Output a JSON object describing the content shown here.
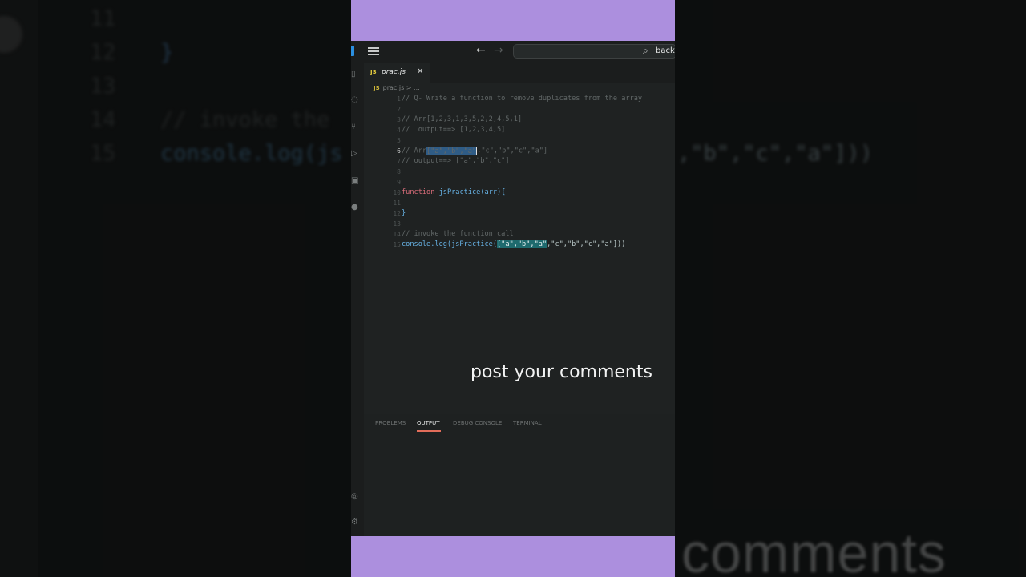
{
  "background": {
    "line_numbers": [
      "11",
      "12",
      "13",
      "14",
      "15"
    ],
    "closing_brace": "}",
    "comment_fragment": "// invoke the",
    "console_fragment": "console.log(js",
    "array_fragment": ",\"b\",\"c\",\"a\"]))",
    "caption_fragment": "comments"
  },
  "titlebar": {
    "search_label": "back"
  },
  "tab": {
    "icon": "JS",
    "label": "prac.js",
    "close": "✕"
  },
  "breadcrumb": {
    "icon": "JS",
    "path": "prac.js > ..."
  },
  "editor": {
    "line_numbers": [
      "1",
      "2",
      "3",
      "4",
      "5",
      "6",
      "7",
      "8",
      "9",
      "10",
      "11",
      "12",
      "13",
      "14",
      "15"
    ],
    "active_line": "6",
    "lines": {
      "l1": "// Q- Write a function to remove duplicates from the array",
      "l3": "// Arr[1,2,3,1,3,5,2,2,4,5,1]",
      "l4": "//  output==> [1,2,3,4,5]",
      "l6a": "// Arr",
      "l6b": "[\"a\",\"b\",\"a\"",
      "l6c": ",\"c\",\"b\",\"c\",\"a\"]",
      "l7a": "// output==> [\"a\",\"b\",",
      "l7b": "\"c\"]",
      "l10_kw": "function",
      "l10_fn": "jsPractice",
      "l10_rest": "(arr){",
      "l12": "}",
      "l14": "// invoke the function call",
      "l15_fn": "console.log(jsPractice(",
      "l15_hl": "[\"a\",\"b\",\"a\"",
      "l15_rest": ",\"c\",\"b\",\"c\",\"a\"]))"
    }
  },
  "caption": "post your comments",
  "panel": {
    "tabs": [
      "PROBLEMS",
      "OUTPUT",
      "DEBUG CONSOLE",
      "TERMINAL"
    ],
    "active_tab": "OUTPUT"
  },
  "colors": {
    "accent_band": "#ac8fde",
    "tab_accent": "#e26d5a",
    "keyword": "#d96d7a",
    "function": "#68b4e7"
  }
}
